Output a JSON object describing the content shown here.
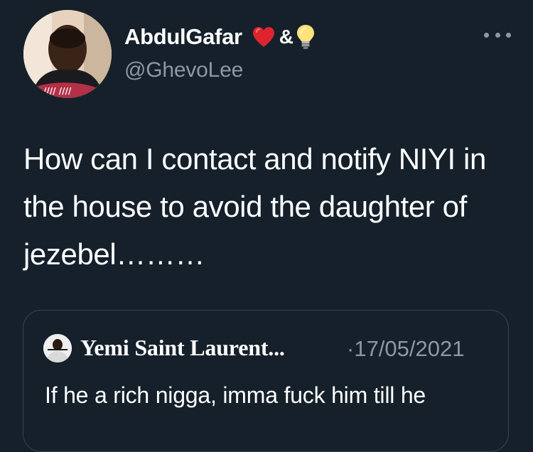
{
  "author": {
    "display_name": "AbdulGafar",
    "name_suffix": "&",
    "handle": "@GhevoLee",
    "emoji_icons": [
      "red-heart-icon",
      "light-bulb-icon"
    ]
  },
  "tweet": {
    "text": "How can I contact and notify NIYI in the house to avoid the daughter of jezebel………"
  },
  "quote": {
    "author_name": "Yemi Saint Laurent...",
    "date": "·17/05/2021",
    "text": "If he a rich nigga, imma fuck him till he"
  },
  "icons": {
    "more": "more-horizontal-icon"
  },
  "colors": {
    "background": "#15202b",
    "secondary_text": "#8b98a5",
    "border": "#38444d",
    "heart": "#e0242f"
  }
}
